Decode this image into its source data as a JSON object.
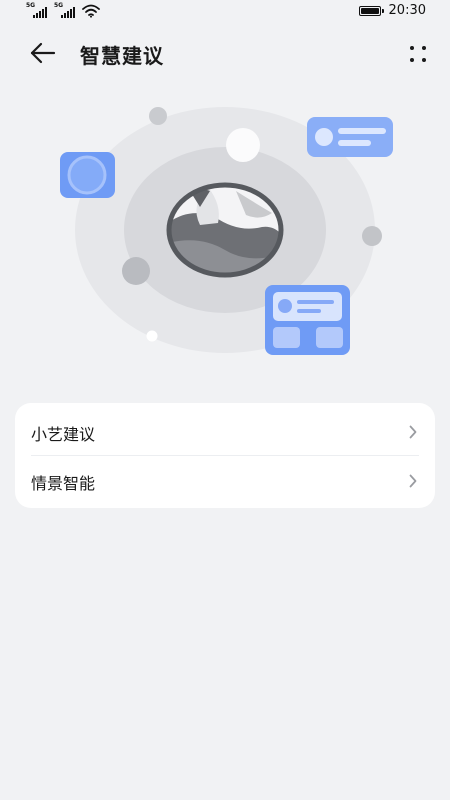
{
  "status_bar": {
    "signal1_label": "5G",
    "signal2_label": "5G",
    "time": "20:30",
    "icons": [
      "signal-icon",
      "signal-icon",
      "wifi-icon",
      "battery-icon"
    ]
  },
  "header": {
    "title": "智慧建议",
    "back_icon": "arrow-left-icon",
    "more_icon": "more-dots-icon"
  },
  "illustration": {
    "colors": {
      "outer_ring": "#e6e7ea",
      "inner_ring": "#d7d8dc",
      "accent_blue": "#6f9bf5",
      "card_blue": "#8aaef7",
      "grey_dot": "#b9bbc0"
    }
  },
  "menu": {
    "items": [
      {
        "label": "小艺建议",
        "icon": "chevron-right-icon"
      },
      {
        "label": "情景智能",
        "icon": "chevron-right-icon"
      }
    ]
  }
}
